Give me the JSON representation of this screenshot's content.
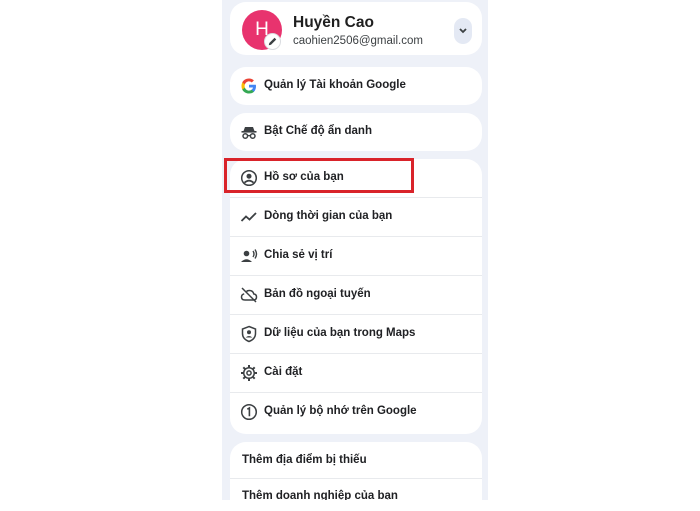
{
  "account": {
    "initial": "H",
    "name": "Huyền Cao",
    "email": "caohien2506@gmail.com"
  },
  "menu": {
    "manage_account": "Quản lý Tài khoản Google",
    "incognito": "Bật Chế độ ẩn danh",
    "profile": "Hồ sơ của bạn",
    "timeline": "Dòng thời gian của bạn",
    "location_sharing": "Chia sẻ vị trí",
    "offline_maps": "Bản đồ ngoại tuyến",
    "your_data": "Dữ liệu của bạn trong Maps",
    "settings": "Cài đặt",
    "storage": "Quản lý bộ nhớ trên Google",
    "add_missing_place": "Thêm địa điểm bị thiếu",
    "add_business": "Thêm doanh nghiệp của bạn"
  },
  "icons": {
    "expand": "chevron-down-icon",
    "manage_account": "google-g-icon",
    "incognito": "incognito-icon",
    "profile": "account-circle-icon",
    "timeline": "timeline-icon",
    "location_sharing": "person-share-icon",
    "offline_maps": "cloud-off-icon",
    "your_data": "shield-person-icon",
    "settings": "gear-icon",
    "storage": "storage-circle-icon"
  },
  "colors": {
    "avatar": "#e8336e",
    "highlight": "#d9232a",
    "panel_background": "#eef1f8"
  }
}
